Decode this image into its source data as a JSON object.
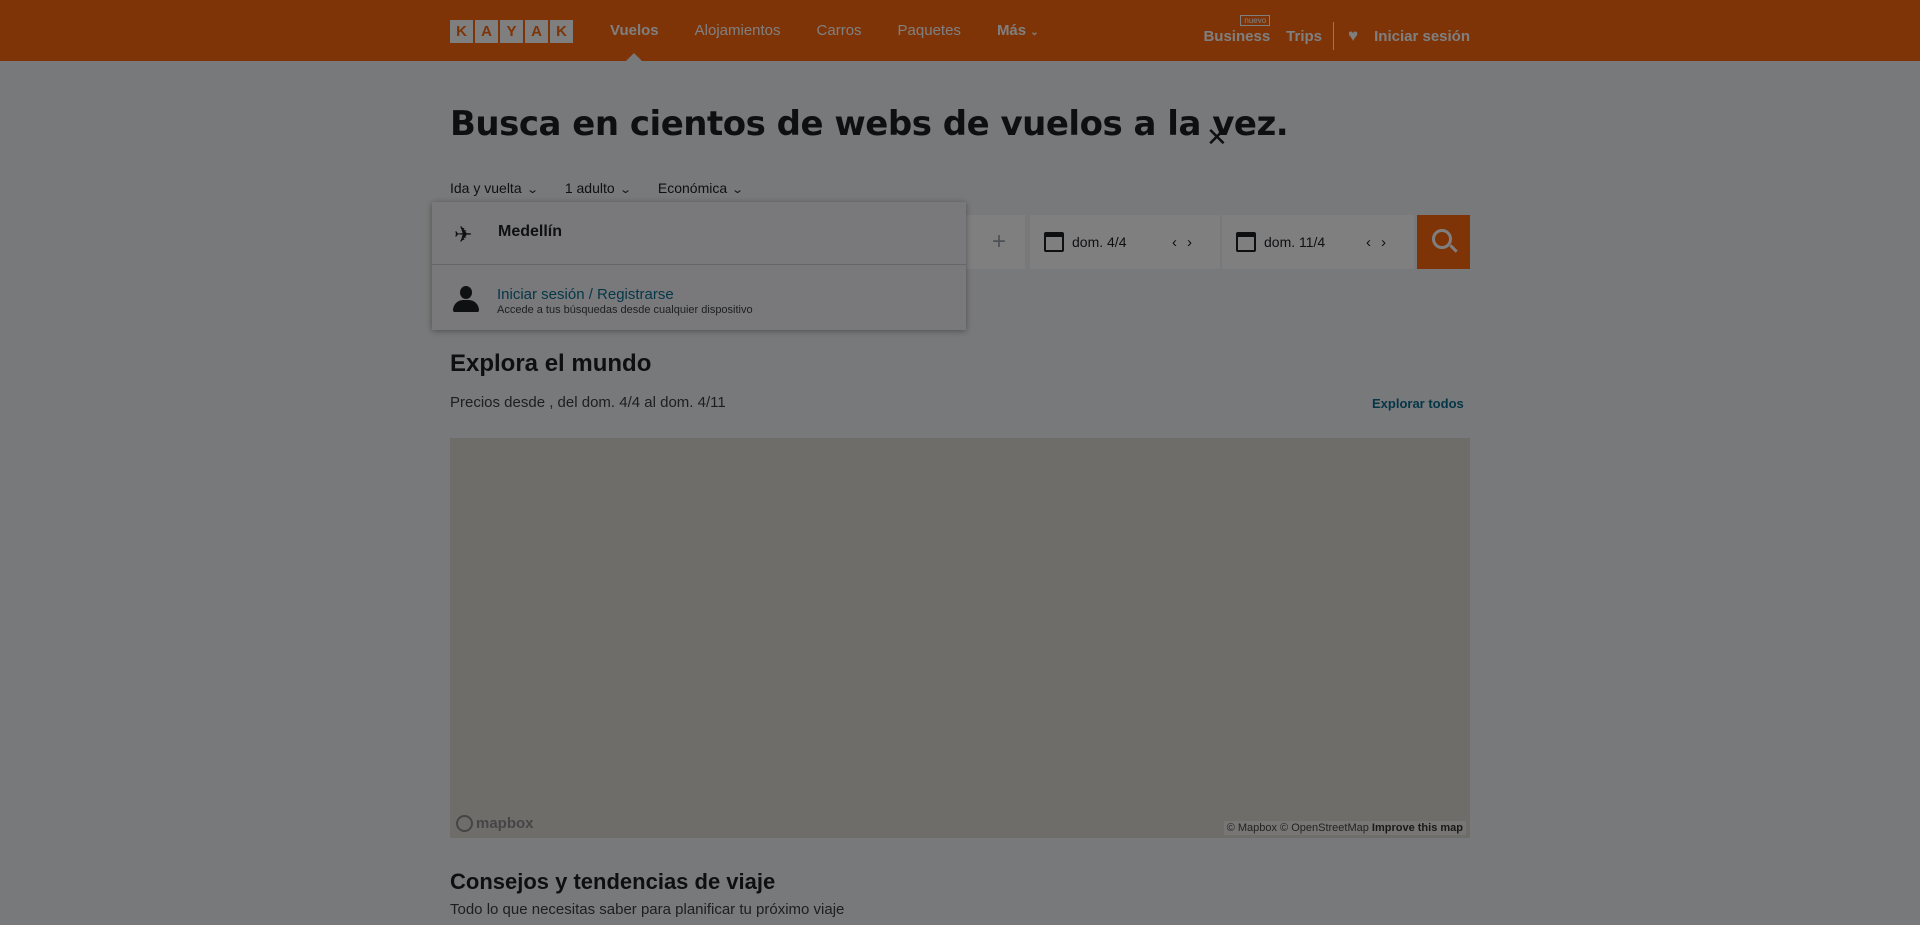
{
  "header": {
    "logo_letters": [
      "K",
      "A",
      "Y",
      "A",
      "K"
    ],
    "nav": [
      "Vuelos",
      "Alojamientos",
      "Carros",
      "Paquetes"
    ],
    "more_label": "Más",
    "business_label": "Business",
    "business_badge": "nuevo",
    "trips_label": "Trips",
    "signin_label": "Iniciar sesión"
  },
  "hero": {
    "title": "Busca en cientos de webs de vuelos a la vez."
  },
  "options": {
    "trip_type": "Ida y vuelta",
    "travelers": "1 adulto",
    "cabin": "Económica"
  },
  "search": {
    "origin_value": "Medellín",
    "depart_date": "dom. 4/4",
    "return_date": "dom. 11/4"
  },
  "dropdown": {
    "signin_link": "Iniciar sesión / Registrarse",
    "signin_desc": "Accede a tus búsquedas desde cualquier dispositivo"
  },
  "explore": {
    "title": "Explora el mundo",
    "subtitle": "Precios desde , del dom. 4/4 al dom. 4/11",
    "explore_all": "Explorar todos",
    "map_logo": "mapbox",
    "map_attr": "© Mapbox © OpenStreetMap",
    "map_improve": "Improve this map"
  },
  "tips": {
    "title": "Consejos y tendencias de viaje",
    "subtitle": "Todo lo que necesitas saber para planificar tu próximo viaje"
  },
  "colors": {
    "brand": "#ff690f",
    "link": "#0b6d91"
  }
}
